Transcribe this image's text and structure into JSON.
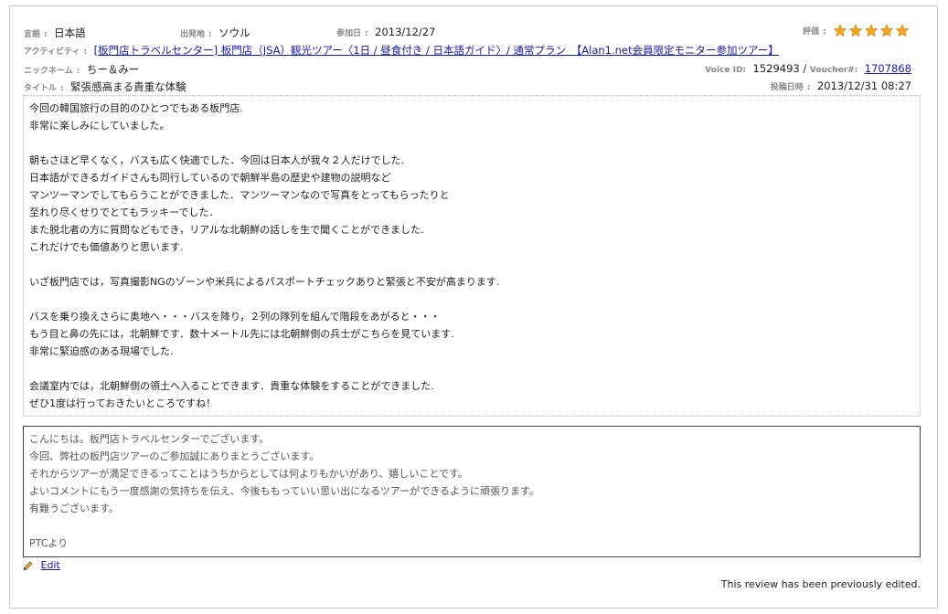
{
  "header": {
    "language_label": "言語",
    "language_value": "日本語",
    "departure_label": "出発地",
    "departure_value": "ソウル",
    "date_label": "参加日",
    "date_value": "2013/12/27",
    "rating_label": "評価",
    "rating": 5,
    "activity_label": "アクティビティ",
    "activity_link": "[板門店トラベルセンター] 板門店（JSA）観光ツアー〈1日 / 昼食付き / 日本語ガイド〉/ 通常プラン　【Alan1.net会員限定モニター参加ツアー】",
    "nickname_label": "ニックネーム",
    "nickname_value": "ちー＆みー",
    "voice_id_label": "Voice ID:",
    "voice_id_value": "1529493 /",
    "voucher_label": "Voucher#:",
    "voucher_value": "1707868",
    "title_label": "タイトル",
    "title_value": "緊張感高まる貴重な体験",
    "posted_label": "投稿日時",
    "posted_value": "2013/12/31 08:27"
  },
  "review_lines": [
    "今回の韓国旅行の目的のひとつでもある板門店.",
    "非常に楽しみにしていました。",
    "",
    "朝もさほど早くなく，バスも広く快適でした．今回は日本人が我々２人だけでした.",
    "日本語ができるガイドさんも同行しているので朝鮮半島の歴史や建物の説明など",
    "マンツーマンでしてもらうことができました．マンツーマンなので写真をとってもらったりと",
    "至れり尽くせりでとてもラッキーでした．",
    "また脱北者の方に質問などもでき，リアルな北朝鮮の話しを生で聞くことができました.",
    "これだけでも価値ありと思います.",
    "",
    "いざ板門店では，写真撮影NGのゾーンや米兵によるパスポートチェックありと緊張と不安が高まります.",
    "",
    "バスを乗り換えさらに奥地へ・・・バスを降り，２列の隊列を組んで階段をあがると・・・",
    "もう目と鼻の先には，北朝鮮です．数十メートル先には北朝鮮側の兵士がこちらを見ています.",
    "非常に緊迫感のある現場でした.",
    "",
    "会議室内では，北朝鮮側の領土へ入ることできます．貴重な体験をすることができました.",
    "ぜひ1度は行っておきたいところですね！"
  ],
  "reply_lines": [
    "こんにちは。板門店トラベルセンターでございます。",
    "今回、弊社の板門店ツアーのご参加誠にありまとうございます。",
    "それからツアーが満足できるってことはうちからとしては何よりもかいがあり、嬉しいことです。",
    "よいコメントにもう一度感謝の気持ちを伝え、今後ももっていい思い出になるツアーができるように頑張ります。",
    "有難うございます。",
    "",
    "PTCより"
  ],
  "edit_label": "Edit",
  "edited_notice": "This review has been previously edited.",
  "colors": {
    "star": "#f5a623",
    "link": "#1a1aa6"
  }
}
